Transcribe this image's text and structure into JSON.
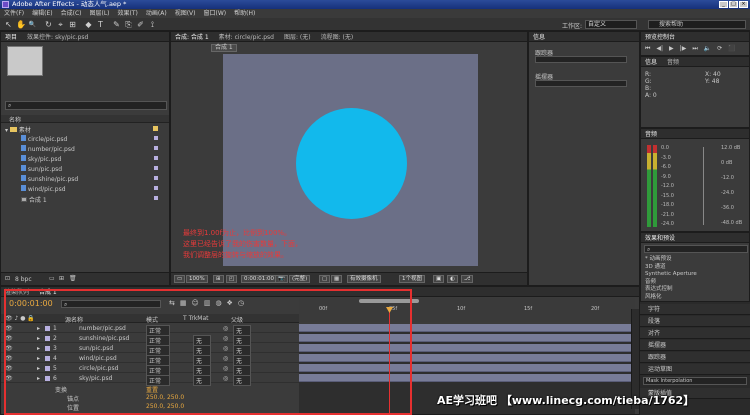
{
  "app": {
    "title": "Adobe After Effects - 动态人气.aep *"
  },
  "menu": [
    "文件(F)",
    "编辑(E)",
    "合成(C)",
    "图层(L)",
    "效果(T)",
    "动画(A)",
    "视图(V)",
    "窗口(W)",
    "帮助(H)"
  ],
  "toolbar": {
    "icons": [
      "↖",
      "✋",
      "🔍",
      "↻",
      "⌖",
      "⊞",
      "◆",
      "T",
      "✎",
      "⎘",
      "✐",
      "⟟"
    ],
    "workspace_label": "工作区:",
    "workspace_value": "自定义",
    "search_help": "搜索帮助"
  },
  "project": {
    "tabs": [
      "项目",
      "效果控件: sky/pic.psd"
    ],
    "col_name": "名称",
    "folder": "素材",
    "items": [
      "circle/pic.psd",
      "number/pic.psd",
      "sky/pic.psd",
      "sun/pic.psd",
      "sunshine/pic.psd",
      "wind/pic.psd"
    ],
    "comp_item": "合成 1",
    "bpc": "8 bpc"
  },
  "comp": {
    "tabs": [
      "合成: 合成 1",
      "素材: circle/pic.psd",
      "图层: (无)",
      "流程图: (无)"
    ],
    "crumb": "合成 1",
    "circle_color": "#12b9ec",
    "annotation_lines": [
      "最终到1.00f为止，比例到100%。",
      "这里已经告诉了我的伤害数量，下面，",
      "我们调整层的旋转与缩放的效果。"
    ],
    "zoom": "100%",
    "timecode": "0:00:01:00",
    "resolution": "(完整)",
    "camera": "有效摄像机",
    "views": "1个视图"
  },
  "info": {
    "tabs": [
      "信息",
      "音频"
    ],
    "r": "R:",
    "g": "G:",
    "b": "B:",
    "a": "A: 0",
    "x": "X: 40",
    "y": "Y: 48"
  },
  "tracker": {
    "label1": "跟踪器",
    "label2": "摇摆器"
  },
  "preview": {
    "title": "预览控制台",
    "buttons": [
      "⏮",
      "◀|",
      "▶",
      "|▶",
      "⏭",
      "🔈",
      "⟳",
      "⬛"
    ]
  },
  "audio": {
    "title": "音频",
    "db_left": [
      "0.0",
      "-3.0",
      "-6.0",
      "-9.0",
      "-12.0",
      "-15.0",
      "-18.0",
      "-21.0",
      "-24.0"
    ],
    "db_right": [
      "12.0 dB",
      "0 dB",
      "-12.0",
      "-24.0",
      "-36.0",
      "-48.0 dB"
    ]
  },
  "effects": {
    "title": "效果和预设",
    "items": [
      "* 动画预设",
      "3D 通道",
      "Synthetic Aperture",
      "音频",
      "表达式控制",
      "风格化"
    ]
  },
  "right_stack": [
    "字符",
    "段落",
    "对齐",
    "摇摆器",
    "跟踪器",
    "运动草图",
    "蒙版插值"
  ],
  "smoother": "Mask Interpolation",
  "timeline": {
    "tabs": [
      "渲染队列",
      "合成 1"
    ],
    "timecode": "0:00:01:00",
    "col_name": "源名称",
    "col_mode": "模式",
    "col_trkmat": "T TrkMat",
    "col_parent": "父级",
    "ruler": [
      "00f",
      "05f",
      "10f",
      "15f",
      "20f"
    ],
    "layers": [
      {
        "num": "1",
        "name": "number/pic.psd",
        "mode": "正常",
        "trk": "",
        "parent": "无"
      },
      {
        "num": "2",
        "name": "sunshine/pic.psd",
        "mode": "正常",
        "trk": "无",
        "parent": "无"
      },
      {
        "num": "3",
        "name": "sun/pic.psd",
        "mode": "正常",
        "trk": "无",
        "parent": "无"
      },
      {
        "num": "4",
        "name": "wind/pic.psd",
        "mode": "正常",
        "trk": "无",
        "parent": "无"
      },
      {
        "num": "5",
        "name": "circle/pic.psd",
        "mode": "正常",
        "trk": "无",
        "parent": "无"
      },
      {
        "num": "6",
        "name": "sky/pic.psd",
        "mode": "正常",
        "trk": "无",
        "parent": "无"
      }
    ],
    "transform_label": "变换",
    "transform_reset": "重置",
    "anchor_label": "锚点",
    "anchor_value": "250.0, 250.0",
    "pos_label": "位置",
    "pos_value": "250.0, 250.0"
  },
  "watermark": "AE学习班吧 【www.linecg.com/tieba/1762】"
}
